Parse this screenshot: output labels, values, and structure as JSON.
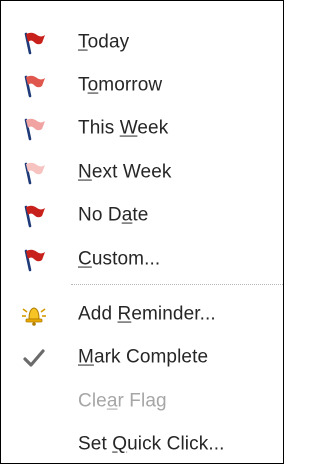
{
  "menu": {
    "items": [
      {
        "pre": "",
        "key": "T",
        "post": "oday",
        "icon": "flag-red-icon"
      },
      {
        "pre": "T",
        "key": "o",
        "post": "morrow",
        "icon": "flag-red-light-icon"
      },
      {
        "pre": "This ",
        "key": "W",
        "post": "eek",
        "icon": "flag-pink-icon"
      },
      {
        "pre": "",
        "key": "N",
        "post": "ext Week",
        "icon": "flag-pale-pink-icon"
      },
      {
        "pre": "No D",
        "key": "a",
        "post": "te",
        "icon": "flag-red-icon"
      },
      {
        "pre": "",
        "key": "C",
        "post": "ustom...",
        "icon": "flag-red-icon"
      },
      {
        "pre": "Add ",
        "key": "R",
        "post": "eminder...",
        "icon": "bell-icon"
      },
      {
        "pre": "",
        "key": "M",
        "post": "ark Complete",
        "icon": "checkmark-icon"
      },
      {
        "pre": "Cle",
        "key": "a",
        "post": "r Flag",
        "icon": "",
        "disabled": true
      },
      {
        "pre": "Set ",
        "key": "Q",
        "post": "uick Click...",
        "icon": ""
      }
    ]
  },
  "colors": {
    "flag_red": "#c8201a",
    "flag_red_light": "#e0574e",
    "flag_pink": "#f0a3a0",
    "flag_pale_pink": "#f6c3c0",
    "pole": "#1f3a78",
    "text": "#262626",
    "disabled_text": "#a6a6a6"
  }
}
